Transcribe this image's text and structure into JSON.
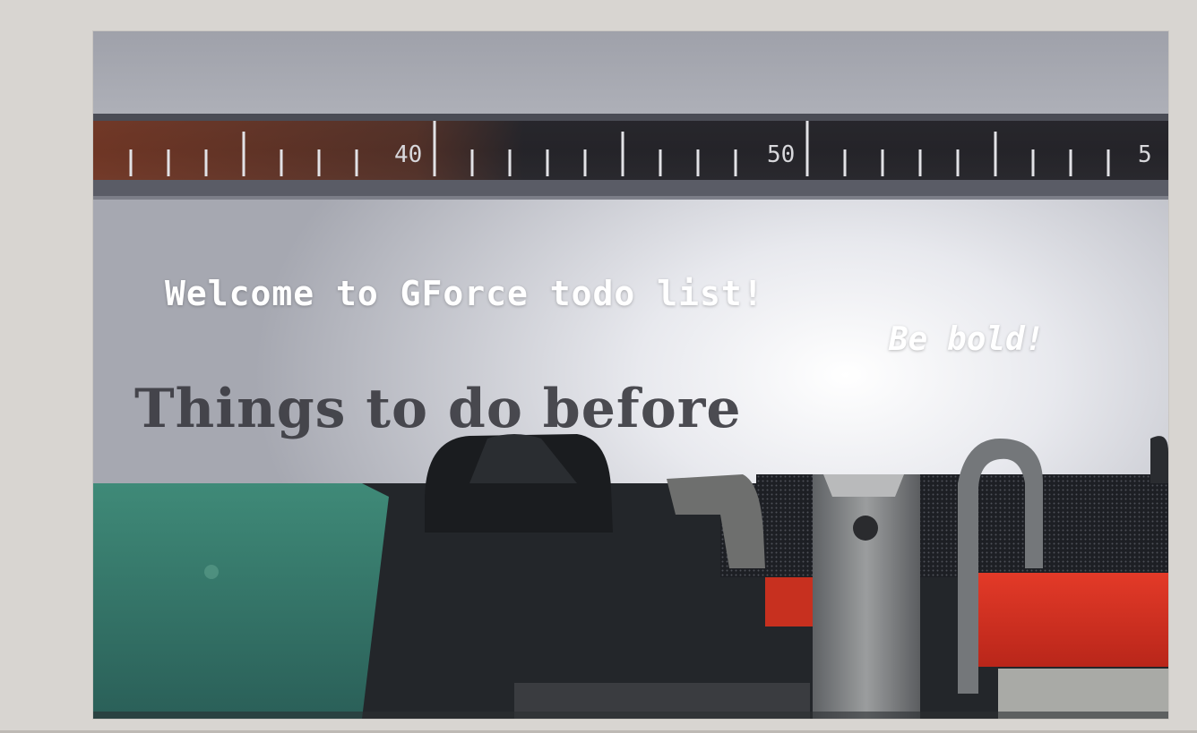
{
  "hero": {
    "welcome_text": "Welcome to GForce todo list!",
    "tagline": "Be bold!",
    "typed_text": "Things to do before",
    "ruler_marks": [
      "40",
      "50",
      "5"
    ]
  },
  "colors": {
    "page_background": "#d8d5d1",
    "paper": "#b4b6bf",
    "ribbon_red": "#d72e1f",
    "teal": "#3f8a78",
    "text": "#ffffff"
  }
}
